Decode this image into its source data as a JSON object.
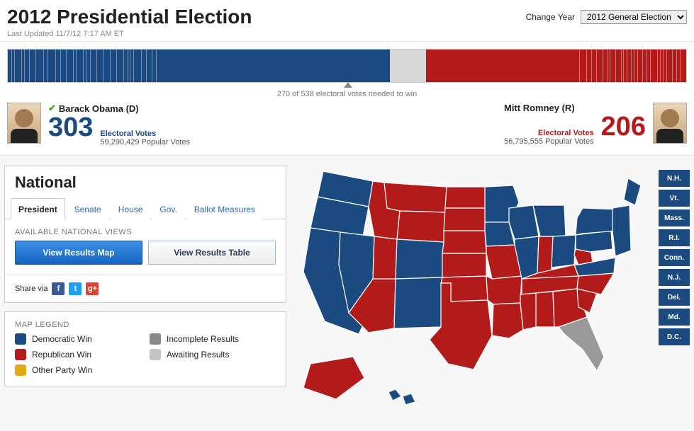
{
  "header": {
    "title": "2012 Presidential Election",
    "timestamp": "Last Updated 11/7/12 7:17 AM ET",
    "change_year_label": "Change Year",
    "year_selected": "2012 General Election"
  },
  "needed_text": "270 of 538 electoral votes needed to win",
  "candidates": {
    "dem": {
      "name": "Barack Obama (D)",
      "ev": "303",
      "ev_label": "Electoral Votes",
      "popular": "59,290,429 Popular Votes",
      "winner": true
    },
    "rep": {
      "name": "Mitt Romney (R)",
      "ev": "206",
      "ev_label": "Electoral Votes",
      "popular": "56,795,555 Popular Votes",
      "winner": false
    }
  },
  "panel": {
    "heading": "National",
    "tabs": [
      "President",
      "Senate",
      "House",
      "Gov.",
      "Ballot Measures"
    ],
    "active_tab": 0,
    "available_label": "AVAILABLE NATIONAL VIEWS",
    "btn_map": "View Results Map",
    "btn_table": "View Results Table",
    "share_label": "Share via"
  },
  "legend": {
    "title": "MAP LEGEND",
    "items": [
      {
        "label": "Democratic Win",
        "color": "#1b4a80"
      },
      {
        "label": "Republican Win",
        "color": "#b31b1b"
      },
      {
        "label": "Other Party Win",
        "color": "#e6a817"
      },
      {
        "label": "Incomplete Results",
        "color": "#8a8a8a"
      },
      {
        "label": "Awaiting Results",
        "color": "#c4c4c4"
      }
    ]
  },
  "small_states": [
    "N.H.",
    "Vt.",
    "Mass.",
    "R.I.",
    "Conn.",
    "N.J.",
    "Del.",
    "Md.",
    "D.C."
  ],
  "chart_data": {
    "type": "choropleth-map",
    "title": "2012 Presidential Election — state winners",
    "categories": [
      "Democratic Win",
      "Republican Win",
      "Incomplete Results"
    ],
    "totals": {
      "dem_ev": 303,
      "rep_ev": 206,
      "total_ev": 538,
      "needed_to_win": 270
    },
    "states": {
      "WA": "D",
      "OR": "D",
      "CA": "D",
      "NV": "D",
      "CO": "D",
      "NM": "D",
      "MN": "D",
      "IA": "D",
      "WI": "D",
      "IL": "D",
      "MI": "D",
      "OH": "D",
      "PA": "D",
      "NY": "D",
      "VT": "D",
      "NH": "D",
      "ME": "D",
      "MA": "D",
      "RI": "D",
      "CT": "D",
      "NJ": "D",
      "DE": "D",
      "MD": "D",
      "DC": "D",
      "VA": "D",
      "HI": "D",
      "ID": "R",
      "MT": "R",
      "WY": "R",
      "UT": "R",
      "AZ": "R",
      "ND": "R",
      "SD": "R",
      "NE": "R",
      "KS": "R",
      "OK": "R",
      "TX": "R",
      "MO": "R",
      "AR": "R",
      "LA": "R",
      "MS": "R",
      "AL": "R",
      "GA": "R",
      "SC": "R",
      "NC": "R",
      "TN": "R",
      "KY": "R",
      "WV": "R",
      "IN": "R",
      "AK": "R",
      "FL": "Incomplete"
    }
  }
}
